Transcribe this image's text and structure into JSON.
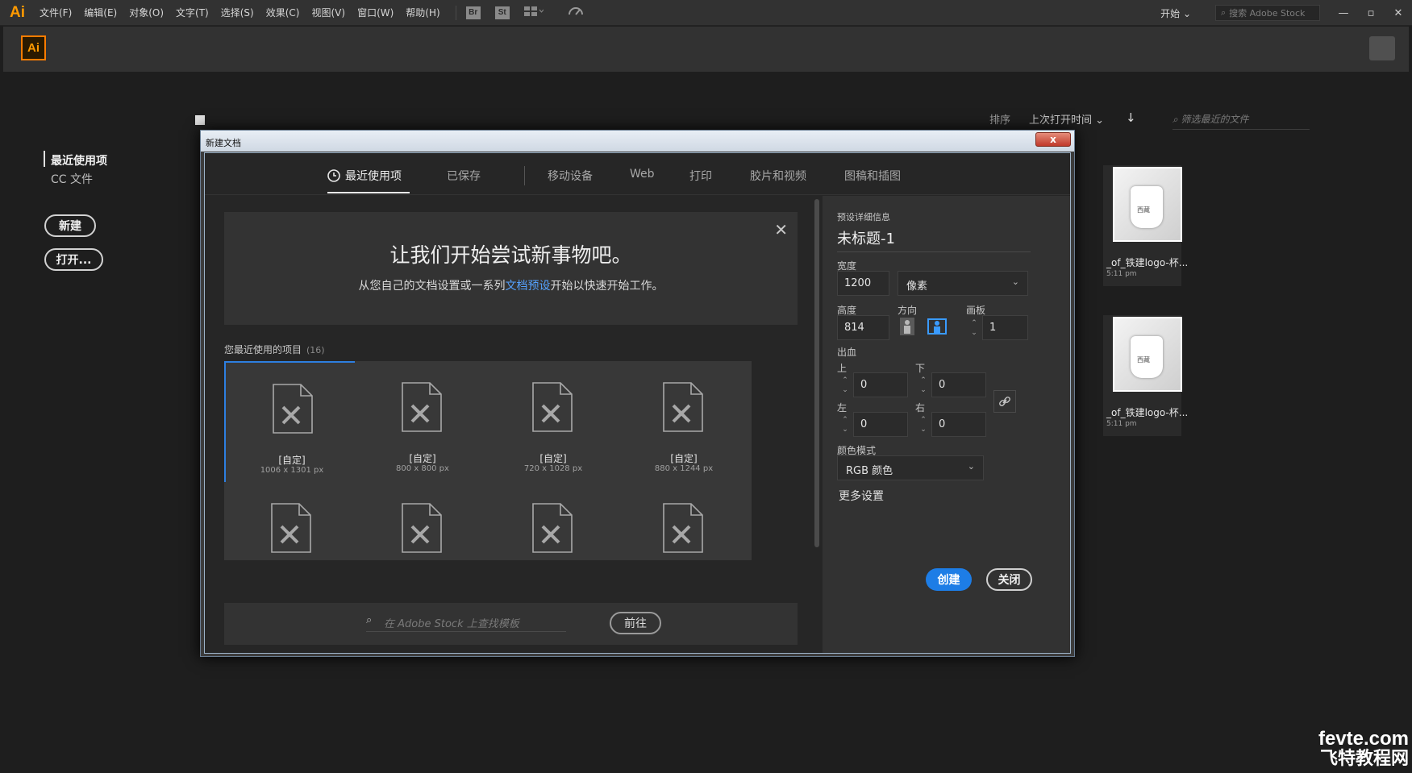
{
  "menubar": {
    "logo": "Ai",
    "items": [
      "文件(F)",
      "编辑(E)",
      "对象(O)",
      "文字(T)",
      "选择(S)",
      "效果(C)",
      "视图(V)",
      "窗口(W)",
      "帮助(H)"
    ],
    "bridge": "Br",
    "stock": "St",
    "workspace": "开始",
    "stock_search_placeholder": "搜索 Adobe Stock"
  },
  "apphead": {
    "logo": "Ai"
  },
  "start": {
    "sidebar": {
      "recent": "最近使用项",
      "cc_files": "CC 文件"
    },
    "new_button": "新建",
    "open_button": "打开...",
    "sort_label": "排序",
    "sort_value": "上次打开时间",
    "filter_placeholder": "筛选最近的文件",
    "thumbnails": [
      {
        "name": "_of_铁建logo-杯...",
        "time": "5:11 pm"
      },
      {
        "name": "_of_铁建logo-杯...",
        "time": "5:11 pm"
      }
    ],
    "cup_label": "西藏"
  },
  "dialog": {
    "title": "新建文档",
    "close": "x",
    "tabs": [
      "最近使用项",
      "已保存",
      "移动设备",
      "Web",
      "打印",
      "胶片和视频",
      "图稿和插图"
    ],
    "hero": {
      "title": "让我们开始尝试新事物吧。",
      "sub_pre": "从您自己的文档设置或一系列",
      "sub_link": "文档预设",
      "sub_post": "开始以快速开始工作。"
    },
    "recent_label": "您最近使用的项目",
    "recent_count": "(16)",
    "tiles": [
      {
        "name": "[自定]",
        "size": "1006 x 1301 px"
      },
      {
        "name": "[自定]",
        "size": "800 x 800 px"
      },
      {
        "name": "[自定]",
        "size": "720 x 1028 px"
      },
      {
        "name": "[自定]",
        "size": "880 x 1244 px"
      }
    ],
    "stock_placeholder": "在 Adobe Stock 上查找模板",
    "stock_go": "前往",
    "preset": {
      "heading": "预设详细信息",
      "doc_name": "未标题-1",
      "width_label": "宽度",
      "width_value": "1200",
      "unit": "像素",
      "height_label": "高度",
      "height_value": "814",
      "orientation_label": "方向",
      "artboards_label": "画板",
      "artboards_value": "1",
      "bleed_label": "出血",
      "top_label": "上",
      "top_value": "0",
      "bottom_label": "下",
      "bottom_value": "0",
      "left_label": "左",
      "left_value": "0",
      "right_label": "右",
      "right_value": "0",
      "color_mode_label": "颜色模式",
      "color_mode_value": "RGB 颜色",
      "more_settings": "更多设置",
      "create": "创建",
      "close": "关闭"
    }
  },
  "watermark": {
    "line1": "fevte.com",
    "line2": "飞特教程网"
  },
  "colors": {
    "accent": "#1d7de6",
    "selected_tile": "#2d7fe0",
    "ai_orange": "#ff9a00",
    "link": "#55a2ff"
  }
}
